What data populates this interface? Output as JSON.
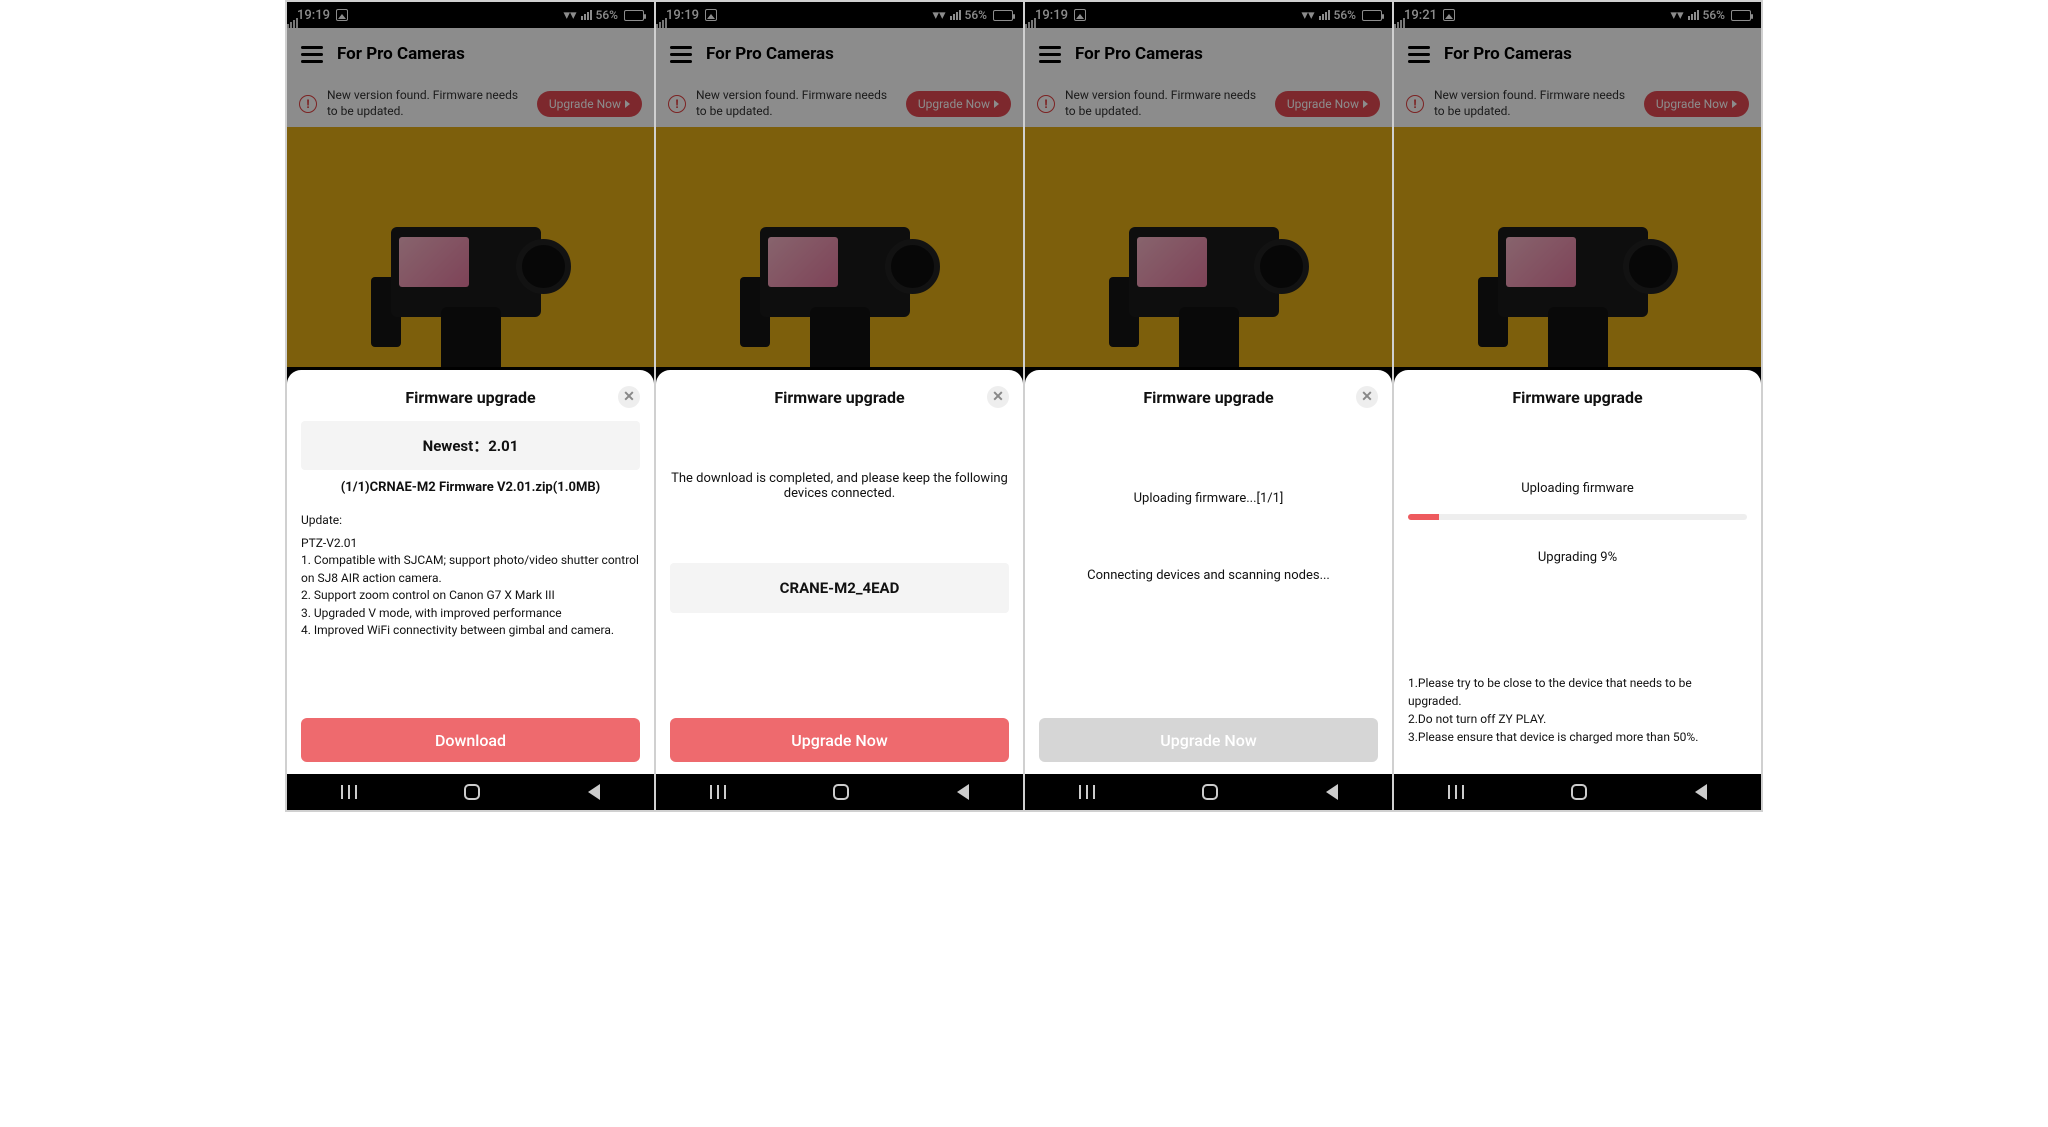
{
  "status": {
    "time_a": "19:19",
    "time_b": "19:21",
    "battery_pct": "56%"
  },
  "header": {
    "menu_icon": "hamburger-icon",
    "title": "For Pro Cameras"
  },
  "banner": {
    "alert_icon": "alert-circle-icon",
    "message": "New version found. Firmware needs to be updated.",
    "button_label": "Upgrade Now",
    "button_arrow_icon": "triangle-right-icon"
  },
  "sheet": {
    "title": "Firmware upgrade",
    "close_icon": "close-icon"
  },
  "pane1": {
    "newest_label": "Newest：2.01",
    "file_label": "(1/1)CRNAE-M2 Firmware V2.01.zip(1.0MB)",
    "update_heading": "Update:",
    "version_line": "PTZ-V2.01",
    "note1": "1. Compatible with SJCAM; support photo/video shutter control on SJ8 AIR action camera.",
    "note2": "2. Support zoom control on Canon G7 X Mark III",
    "note3": "3. Upgraded V mode, with improved performance",
    "note4": "4. Improved WiFi connectivity between gimbal and camera.",
    "button": "Download"
  },
  "pane2": {
    "message": "The download is completed, and please keep the following devices connected.",
    "device": "CRANE-M2_4EAD",
    "button": "Upgrade Now"
  },
  "pane3": {
    "line1": "Uploading firmware...[1/1]",
    "line2": "Connecting devices and scanning nodes...",
    "button": "Upgrade Now"
  },
  "pane4": {
    "status_line": "Uploading firmware",
    "progress_pct": 9,
    "progress_label": "Upgrading 9%",
    "tip1": "1.Please try to be close to the device that needs to be upgraded.",
    "tip2": "2.Do not turn off ZY PLAY.",
    "tip3": "3.Please ensure that device is charged more than 50%."
  },
  "nav": {
    "recent_icon": "recents-icon",
    "home_icon": "home-icon",
    "back_icon": "back-icon"
  }
}
